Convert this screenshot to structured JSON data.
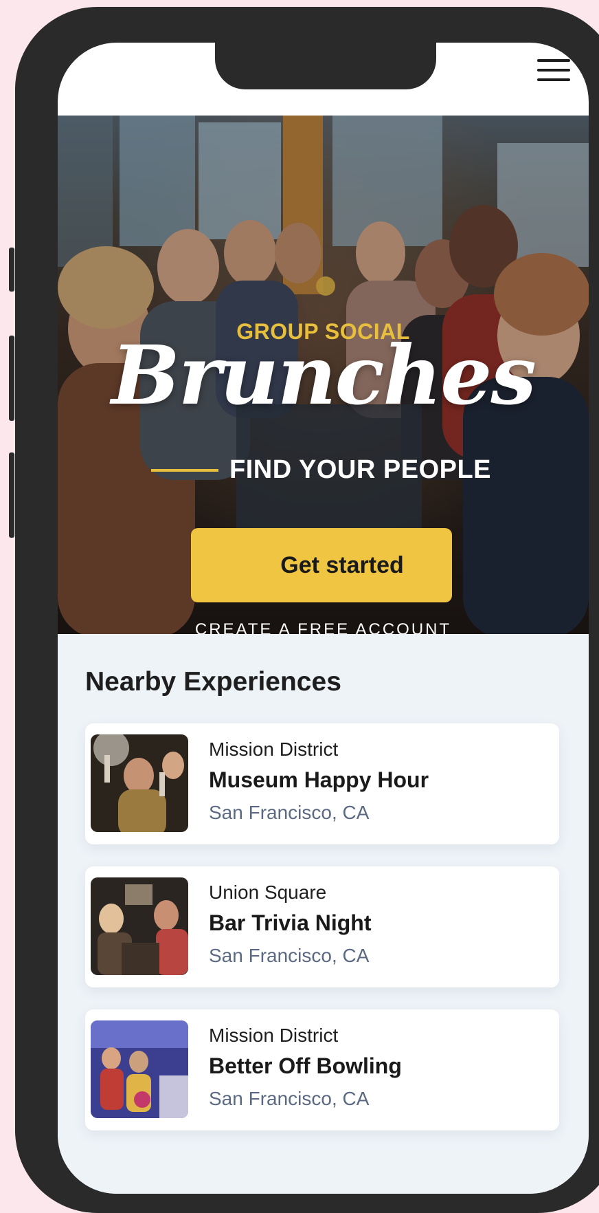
{
  "hero": {
    "kicker": "GROUP SOCIAL",
    "title": "Brunches",
    "subtitle": "FIND YOUR PEOPLE",
    "cta_label": "Get started",
    "cta_sublabel": "CREATE A FREE ACCOUNT"
  },
  "colors": {
    "accent": "#f0c542",
    "background": "#fce8ec",
    "location_text": "#5b6a82"
  },
  "nearby": {
    "title": "Nearby Experiences",
    "items": [
      {
        "neighborhood": "Mission District",
        "title": "Museum Happy Hour",
        "location": "San Francisco, CA"
      },
      {
        "neighborhood": "Union Square",
        "title": "Bar Trivia Night",
        "location": "San Francisco, CA"
      },
      {
        "neighborhood": "Mission District",
        "title": "Better Off Bowling",
        "location": "San Francisco, CA"
      }
    ]
  },
  "icons": {
    "menu": "hamburger-menu-icon"
  }
}
